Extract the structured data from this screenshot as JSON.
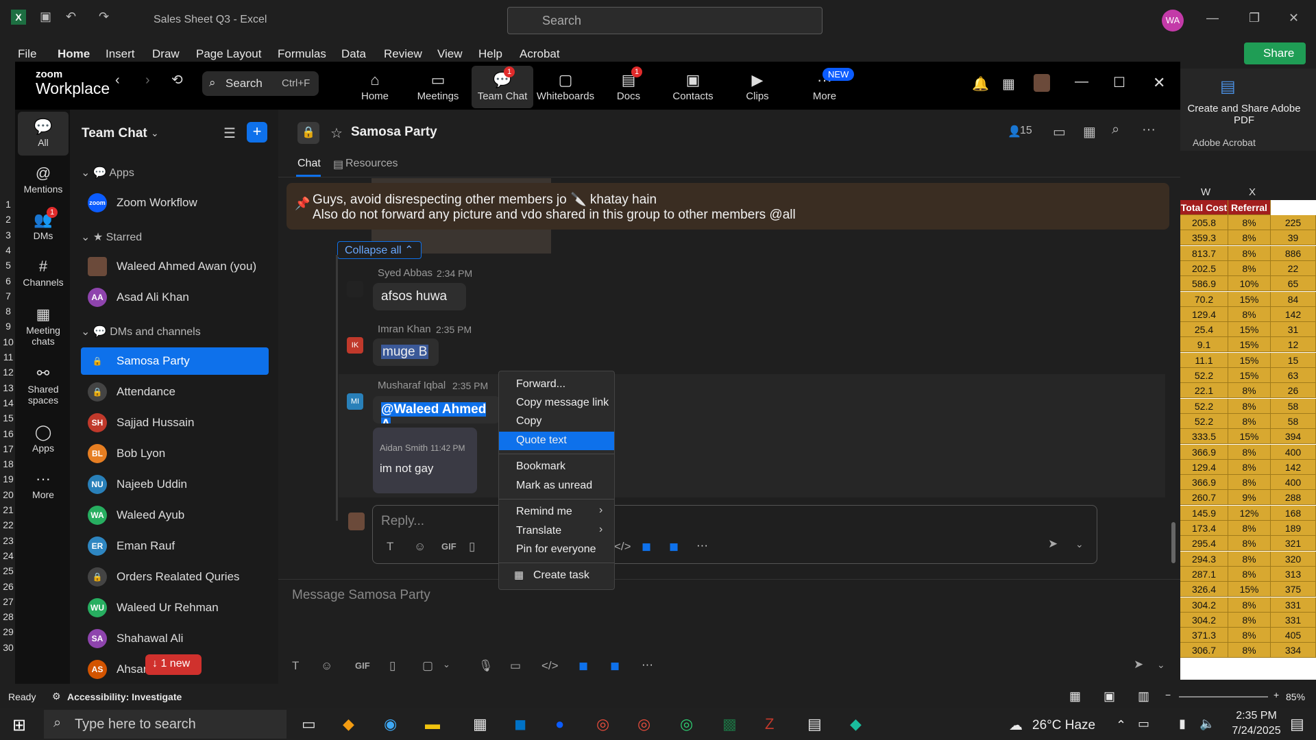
{
  "excel": {
    "title": "Sales Sheet Q3  -  Excel",
    "search_placeholder": "Search",
    "avatar": "WA",
    "share": "Share",
    "tabs": [
      "File",
      "Home",
      "Insert",
      "Draw",
      "Page Layout",
      "Formulas",
      "Data",
      "Review",
      "View",
      "Help",
      "Acrobat"
    ],
    "acrobat_btn": "Create and Share Adobe PDF",
    "acrobat_group": "Adobe Acrobat",
    "col_headers": [
      "W",
      "X"
    ],
    "header_cells": [
      "Total Cost",
      "Referral"
    ],
    "rows": [
      [
        "205.8",
        "8%",
        "225"
      ],
      [
        "359.3",
        "8%",
        "39"
      ],
      [
        "813.7",
        "8%",
        "886"
      ],
      [
        "202.5",
        "8%",
        "22"
      ],
      [
        "586.9",
        "10%",
        "65"
      ],
      [
        "70.2",
        "15%",
        "84"
      ],
      [
        "129.4",
        "8%",
        "142"
      ],
      [
        "25.4",
        "15%",
        "31"
      ],
      [
        "9.1",
        "15%",
        "12"
      ],
      [
        "11.1",
        "15%",
        "15"
      ],
      [
        "52.2",
        "15%",
        "63"
      ],
      [
        "22.1",
        "8%",
        "26"
      ],
      [
        "52.2",
        "8%",
        "58"
      ],
      [
        "52.2",
        "8%",
        "58"
      ],
      [
        "333.5",
        "15%",
        "394"
      ],
      [
        "366.9",
        "8%",
        "400"
      ],
      [
        "129.4",
        "8%",
        "142"
      ],
      [
        "366.9",
        "8%",
        "400"
      ],
      [
        "260.7",
        "9%",
        "288"
      ],
      [
        "145.9",
        "12%",
        "168"
      ],
      [
        "173.4",
        "8%",
        "189"
      ],
      [
        "295.4",
        "8%",
        "321"
      ],
      [
        "294.3",
        "8%",
        "320"
      ],
      [
        "287.1",
        "8%",
        "313"
      ],
      [
        "326.4",
        "15%",
        "375"
      ],
      [
        "304.2",
        "8%",
        "331"
      ],
      [
        "304.2",
        "8%",
        "331"
      ],
      [
        "371.3",
        "8%",
        "405"
      ],
      [
        "306.7",
        "8%",
        "334"
      ]
    ],
    "row_numbers": [
      "1",
      "2",
      "3",
      "4",
      "5",
      "6",
      "7",
      "8",
      "9",
      "10",
      "11",
      "12",
      "13",
      "14",
      "15",
      "16",
      "17",
      "18",
      "19",
      "20",
      "21",
      "22",
      "23",
      "24",
      "25",
      "26",
      "27",
      "28",
      "29",
      "30"
    ],
    "status_ready": "Ready",
    "accessibility": "Accessibility: Investigate",
    "zoom_level": "85%"
  },
  "zoom": {
    "brand_line1": "zoom",
    "brand_line2": "Workplace",
    "search": "Search",
    "search_shortcut": "Ctrl+F",
    "nav": [
      {
        "label": "Home",
        "icon": "⌂",
        "badge": ""
      },
      {
        "label": "Meetings",
        "icon": "▭",
        "badge": ""
      },
      {
        "label": "Team Chat",
        "icon": "💬",
        "badge": "1"
      },
      {
        "label": "Whiteboards",
        "icon": "▢",
        "badge": ""
      },
      {
        "label": "Docs",
        "icon": "▤",
        "badge": "1"
      },
      {
        "label": "Contacts",
        "icon": "▣",
        "badge": ""
      },
      {
        "label": "Clips",
        "icon": "▶",
        "badge": ""
      },
      {
        "label": "More",
        "icon": "···",
        "badge": ""
      }
    ],
    "new_badge": "NEW",
    "rail": [
      {
        "label": "All",
        "icon": "💬"
      },
      {
        "label": "Mentions",
        "icon": "@"
      },
      {
        "label": "DMs",
        "icon": "👥"
      },
      {
        "label": "Channels",
        "icon": "#"
      },
      {
        "label": "Meeting chats",
        "icon": "▦"
      },
      {
        "label": "Shared spaces",
        "icon": "⚯"
      },
      {
        "label": "Apps",
        "icon": "◯"
      },
      {
        "label": "More",
        "icon": "···"
      }
    ],
    "list_title": "Team Chat",
    "sections": {
      "apps": "Apps",
      "starred": "Starred",
      "dms": "DMs and channels"
    },
    "apps_items": [
      {
        "name": "Zoom Workflow",
        "initials": "zoom",
        "color": "#0b5cff"
      }
    ],
    "starred_items": [
      {
        "name": "Waleed Ahmed Awan (you)",
        "initials": "",
        "color": "#6b4a3a"
      },
      {
        "name": "Asad Ali Khan",
        "initials": "AA",
        "color": "#8e44ad"
      }
    ],
    "dm_items": [
      {
        "name": "Samosa Party",
        "initials": "🔒",
        "color": "transparent"
      },
      {
        "name": "Attendance",
        "initials": "🔒",
        "color": "#444"
      },
      {
        "name": "Sajjad Hussain",
        "initials": "SH",
        "color": "#c0392b"
      },
      {
        "name": "Bob Lyon",
        "initials": "BL",
        "color": "#e67e22"
      },
      {
        "name": "Najeeb Uddin",
        "initials": "NU",
        "color": "#2980b9"
      },
      {
        "name": "Waleed Ayub",
        "initials": "WA",
        "color": "#27ae60"
      },
      {
        "name": "Eman Rauf",
        "initials": "ER",
        "color": "#2e86c1"
      },
      {
        "name": "Orders Realated Quries",
        "initials": "🔒",
        "color": "#444"
      },
      {
        "name": "Waleed Ur Rehman",
        "initials": "WU",
        "color": "#27ae60"
      },
      {
        "name": "Shahawal Ali",
        "initials": "SA",
        "color": "#8e44ad"
      },
      {
        "name": "Ahsan",
        "initials": "AS",
        "color": "#d35400"
      }
    ],
    "new_pill": "↓ 1 new",
    "channel": {
      "name": "Samosa Party",
      "member_count": "15",
      "tabs": [
        "Chat",
        "Resources"
      ],
      "pinned_line1": "Guys, avoid disrespecting other members jo 🔪 khatay hain",
      "pinned_line2": "Also do not forward any picture and vdo shared in this group to other members @all",
      "collapse_all": "Collapse all ⌃"
    },
    "messages": [
      {
        "author": "Syed Abbas",
        "time": "2:34 PM",
        "text": "afsos huwa",
        "initials": ""
      },
      {
        "author": "Imran Khan",
        "time": "2:35 PM",
        "text": "muge B",
        "initials": "IK"
      },
      {
        "author": "Musharaf Iqbal",
        "time": "2:35 PM",
        "text": "@Waleed Ahmed A",
        "initials": "MI"
      }
    ],
    "quoted": {
      "author": "Aidan Smith",
      "time": "11:42 PM",
      "text": "im not gay"
    },
    "reply_placeholder": "Reply...",
    "compose_placeholder": "Message Samosa Party",
    "context_menu": [
      "Forward...",
      "Copy message link",
      "Copy",
      "Quote text",
      "Bookmark",
      "Mark as unread",
      "Remind me",
      "Translate",
      "Pin for everyone",
      "Create task"
    ]
  },
  "taskbar": {
    "search": "Type here to search",
    "weather": "26°C  Haze",
    "time": "2:35 PM",
    "date": "7/24/2025"
  },
  "colors": {
    "accent": "#0e71eb",
    "excel_green": "#1f9d55",
    "badge_red": "#e02b2b"
  }
}
